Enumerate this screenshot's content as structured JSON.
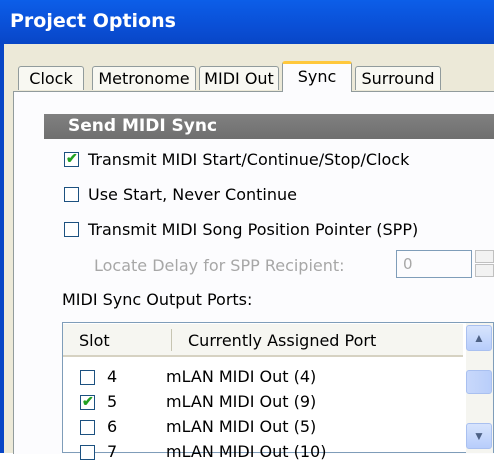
{
  "window": {
    "title": "Project Options"
  },
  "tabs": [
    {
      "label": "Clock"
    },
    {
      "label": "Metronome"
    },
    {
      "label": "MIDI Out"
    },
    {
      "label": "Sync",
      "active": true
    },
    {
      "label": "Surround"
    }
  ],
  "section": {
    "title": "Send MIDI Sync"
  },
  "options": [
    {
      "label": "Transmit MIDI Start/Continue/Stop/Clock",
      "checked": true
    },
    {
      "label": "Use Start, Never Continue",
      "checked": false
    },
    {
      "label": "Transmit MIDI Song Position Pointer (SPP)",
      "checked": false
    }
  ],
  "locate_delay": {
    "label": "Locate Delay for SPP Recipient:",
    "value": "0",
    "disabled": true
  },
  "ports": {
    "label": "MIDI Sync Output Ports:",
    "columns": [
      "Slot",
      "Currently Assigned Port"
    ],
    "rows": [
      {
        "slot": "4",
        "port": "mLAN MIDI Out (4)",
        "checked": false
      },
      {
        "slot": "5",
        "port": "mLAN MIDI Out (9)",
        "checked": true
      },
      {
        "slot": "6",
        "port": "mLAN MIDI Out (5)",
        "checked": false
      },
      {
        "slot": "7",
        "port": "mLAN MIDI Out (10)",
        "checked": false
      }
    ]
  },
  "icons": {
    "check": "checkmark-icon",
    "scroll_up": "chevron-up-icon",
    "scroll_down": "chevron-down-icon"
  }
}
